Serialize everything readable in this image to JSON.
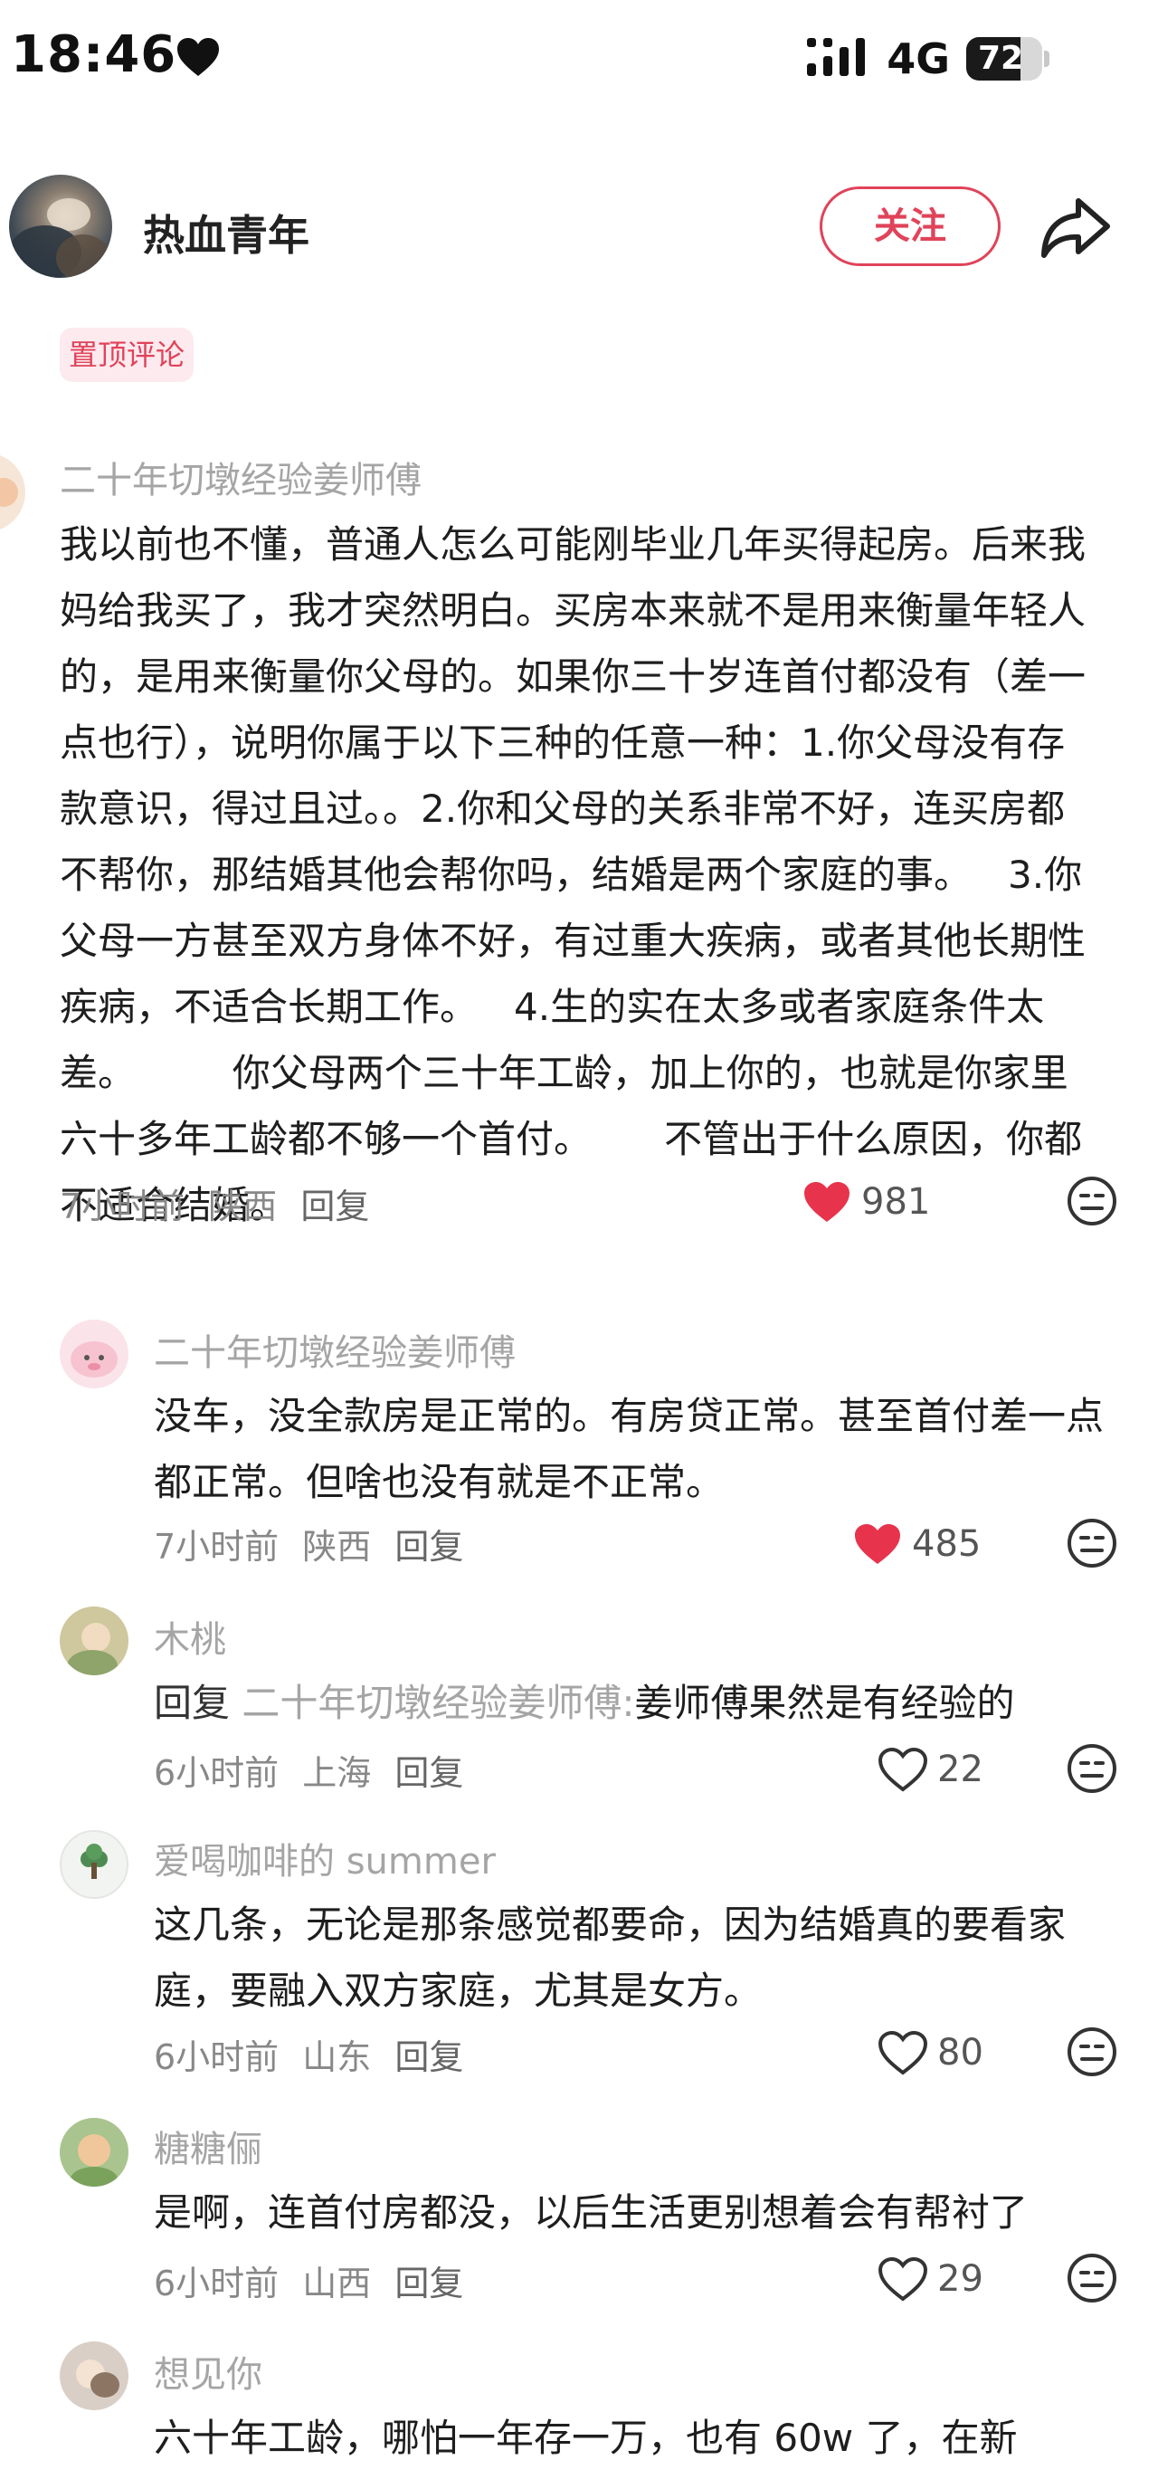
{
  "status_bar": {
    "time": "18:46",
    "network": "4G",
    "battery": "72",
    "battery_level": 0.72
  },
  "header": {
    "author_name": "热血青年",
    "follow_label": "关注"
  },
  "pinned_label": "置顶评论",
  "comments": [
    {
      "name": "二十年切墩经验姜师傅",
      "text": "我以前也不懂，普通人怎么可能刚毕业几年买得起房。后来我妈给我买了，我才突然明白。买房本来就不是用来衡量年轻人的，是用来衡量你父母的。如果你三十岁连首付都没有（差一点也行），说明你属于以下三种的任意一种：1.你父母没有存款意识，得过且过。。2.你和父母的关系非常不好，连买房都不帮你，那结婚其他会帮你吗，结婚是两个家庭的事。   3.你父母一方甚至双方身体不好，有过重大疾病，或者其他长期性疾病，不适合长期工作。   4.生的实在太多或者家庭条件太差。        你父母两个三十年工龄，加上你的，也就是你家里六十多年工龄都不够一个首付。      不管出于什么原因，你都不适合结婚。",
      "time": "7小时前",
      "location": "陕西",
      "reply_label": "回复",
      "likes": "981",
      "liked": true
    },
    {
      "name": "二十年切墩经验姜师傅",
      "text": "没车，没全款房是正常的。有房贷正常。甚至首付差一点都正常。但啥也没有就是不正常。",
      "time": "7小时前",
      "location": "陕西",
      "reply_label": "回复",
      "likes": "485",
      "liked": true
    },
    {
      "name": "木桃",
      "reply_prefix": "回复",
      "reply_to": "二十年切墩经验姜师傅:",
      "text": "姜师傅果然是有经验的",
      "time": "6小时前",
      "location": "上海",
      "reply_label": "回复",
      "likes": "22",
      "liked": false
    },
    {
      "name": "爱喝咖啡的 summer",
      "text": "这几条，无论是那条感觉都要命，因为结婚真的要看家庭，要融入双方家庭，尤其是女方。",
      "time": "6小时前",
      "location": "山东",
      "reply_label": "回复",
      "likes": "80",
      "liked": false
    },
    {
      "name": "糖糖俪",
      "text": "是啊，连首付房都没，以后生活更别想着会有帮衬了",
      "time": "6小时前",
      "location": "山西",
      "reply_label": "回复",
      "likes": "29",
      "liked": false
    },
    {
      "name": "想见你",
      "text": "六十年工龄，哪怕一年存一万，也有 60w 了，在新"
    }
  ],
  "colors": {
    "accent": "#e0435a",
    "name_gray": "#a5a5a5"
  }
}
